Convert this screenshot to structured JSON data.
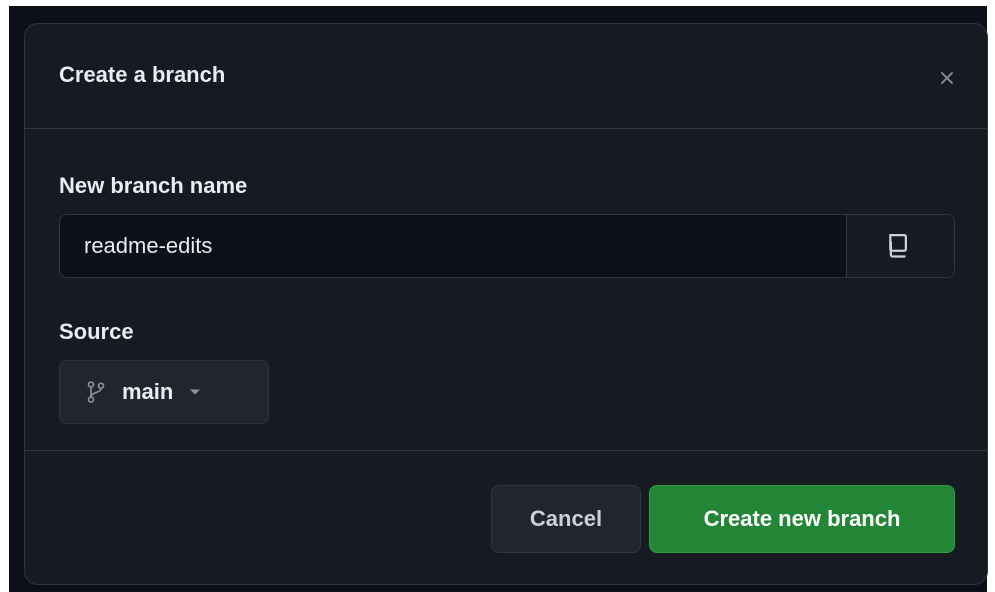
{
  "dialog": {
    "title": "Create a branch",
    "close_icon": "close-icon"
  },
  "form": {
    "branch_name_label": "New branch name",
    "branch_name_value": "readme-edits",
    "copy_icon": "copy-icon",
    "source_label": "Source",
    "source_branch": "main",
    "source_icon": "git-branch-icon",
    "dropdown_icon": "triangle-down-icon"
  },
  "footer": {
    "cancel_label": "Cancel",
    "create_label": "Create new branch"
  },
  "colors": {
    "background": "#161b22",
    "border": "#30363d",
    "primary": "#238636",
    "text": "#e6edf3"
  }
}
